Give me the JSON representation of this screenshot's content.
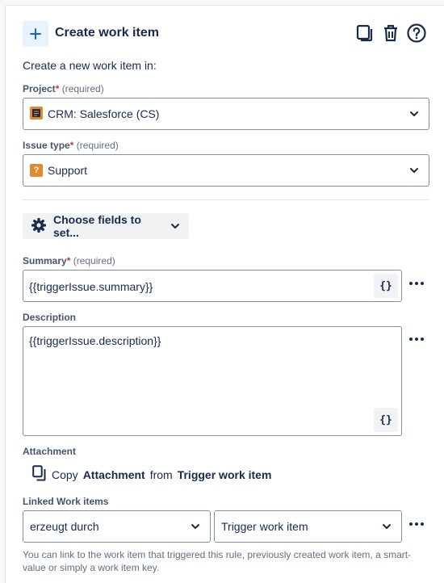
{
  "header": {
    "title": "Create work item",
    "icons": [
      "plus-icon",
      "copy-icon",
      "trash-icon",
      "help-icon"
    ]
  },
  "intro": "Create a new work item in:",
  "project": {
    "label": "Project",
    "required_mark": "*",
    "required_text": "(required)",
    "value": "CRM: Salesforce (CS)"
  },
  "issue_type": {
    "label": "Issue type",
    "required_mark": "*",
    "required_text": "(required)",
    "value": "Support",
    "icon_glyph": "?"
  },
  "choose_fields": {
    "label": "Choose fields to set..."
  },
  "summary": {
    "label": "Summary",
    "required_mark": "*",
    "required_text": "(required)",
    "value": "{{triggerIssue.summary}}"
  },
  "description": {
    "label": "Description",
    "value": "{{triggerIssue.description}}"
  },
  "smart_value_button": "{}",
  "more_button": "•••",
  "attachment": {
    "label": "Attachment",
    "copy_prefix": "Copy",
    "copy_what": "Attachment",
    "copy_from": "from",
    "copy_source": "Trigger work item"
  },
  "linked": {
    "label": "Linked Work items",
    "link_type": "erzeugt durch",
    "target": "Trigger work item",
    "help": "You can link to the work item that triggered this rule, previously created work item, a smart-value or simply a work item key."
  },
  "colors": {
    "accent_blue": "#0c66e4",
    "required_red": "#c9372c",
    "support_orange": "#e2892f"
  }
}
